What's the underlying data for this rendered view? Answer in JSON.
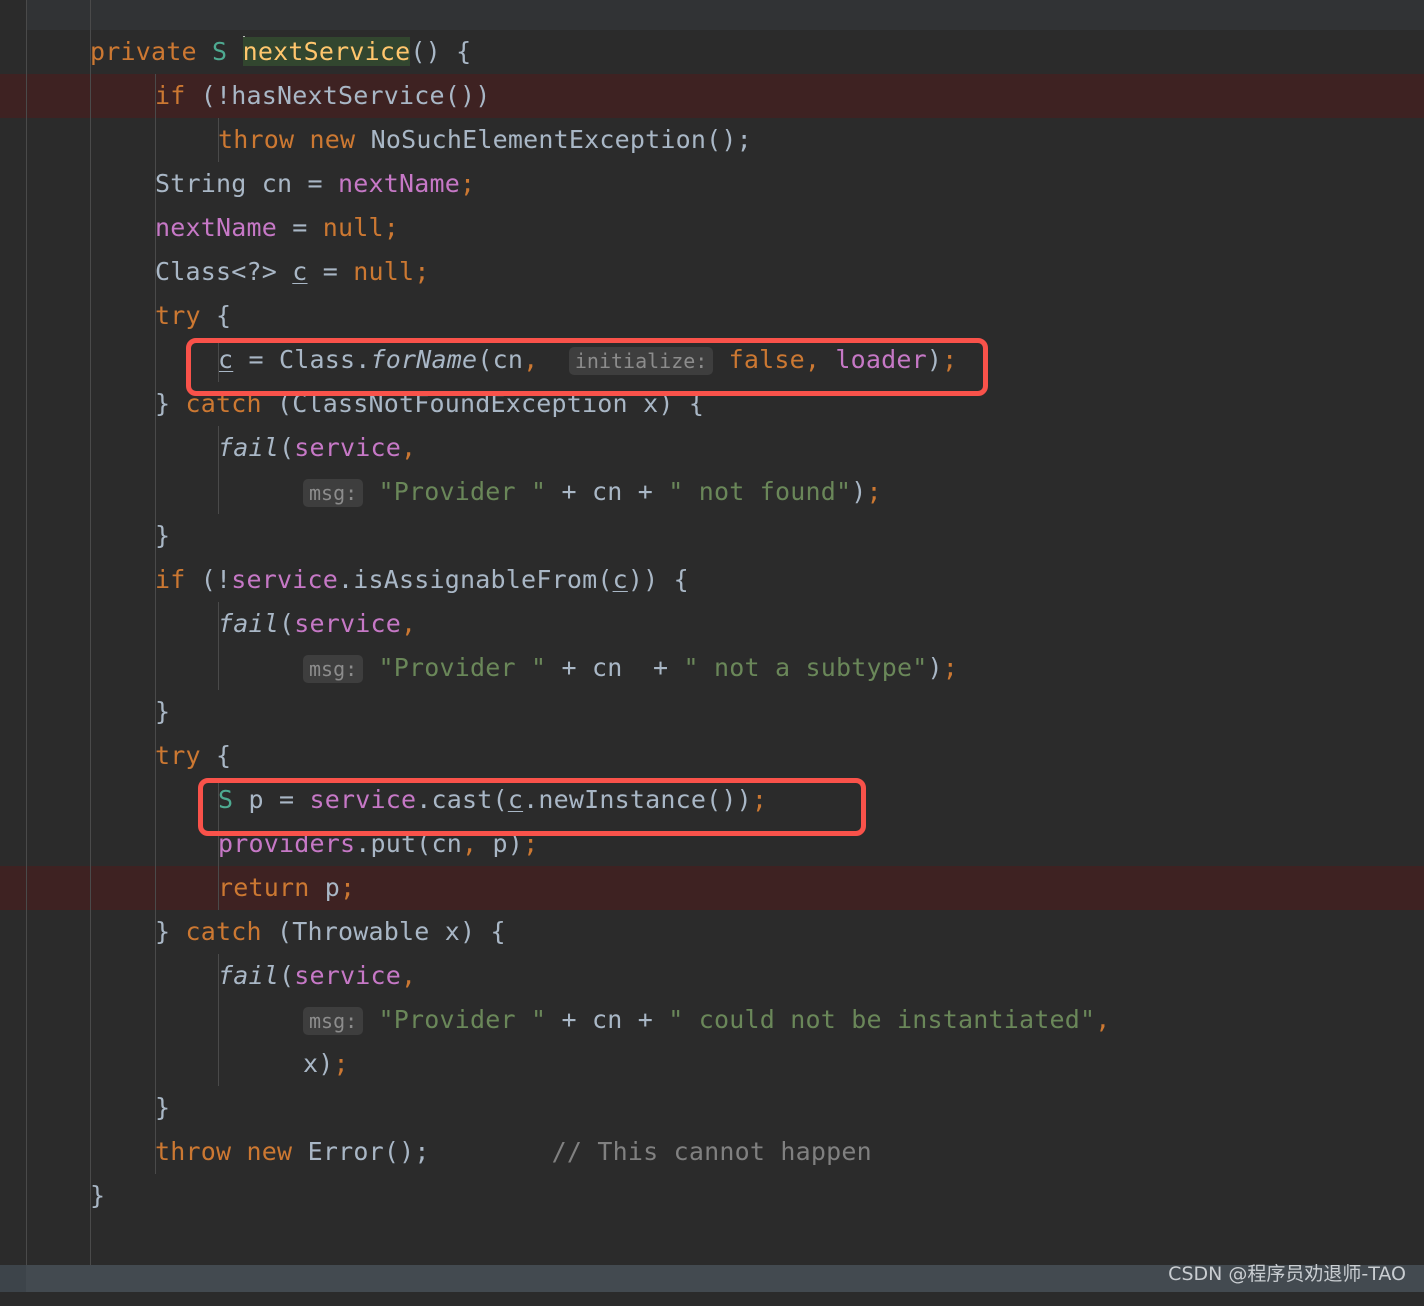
{
  "app": {
    "type": "code-editor",
    "language": "Java",
    "theme": "darcula",
    "background": "#2b2b2b",
    "error_line_background": "#3e2222",
    "annotation_color": "#f9524a",
    "caret_highlight_background": "#32462f"
  },
  "caret": {
    "highlighted_identifier": "nextService"
  },
  "annotations": [
    {
      "name": "forName-call-box",
      "target_line": 8,
      "label": "red rounded rectangle around Class.forName call"
    },
    {
      "name": "newInstance-call-box",
      "target_line": 18,
      "label": "red rounded rectangle around service.cast newInstance call"
    }
  ],
  "inlay_hints": [
    {
      "name": "initialize-hint",
      "text": "initialize:"
    },
    {
      "name": "msg-hint-1",
      "text": "msg:"
    },
    {
      "name": "msg-hint-2",
      "text": "msg:"
    },
    {
      "name": "msg-hint-3",
      "text": "msg:"
    }
  ],
  "code": {
    "l1": {
      "kw_private": "private",
      "gen_S": "S",
      "method": "nextService",
      "tail": "() {"
    },
    "l2": {
      "kw_if": "if",
      "body": " (!hasNextService())"
    },
    "l3": {
      "kw_throw": "throw",
      "kw_new": "new",
      "cls": "NoSuchElementException",
      "tail": "();"
    },
    "l4": {
      "cls": "String",
      "var": " cn = ",
      "fld": "nextName",
      "semi": ";"
    },
    "l5": {
      "fld": "nextName",
      "op": " = ",
      "kw_null": "null",
      "semi": ";"
    },
    "l6": {
      "cls": "Class<?> ",
      "lvar": "c",
      "op": " = ",
      "kw_null": "null",
      "semi": ";"
    },
    "l7": {
      "kw_try": "try",
      "tail": " {"
    },
    "l8": {
      "lvar": "c",
      "op": " = ",
      "cls": "Class.",
      "mth_ital": "forName",
      "p1": "(cn",
      "comma1": ",",
      "hint": "initialize:",
      "kw_false": "false",
      "comma2": ",",
      "fld_loader": "loader",
      "tail": ")",
      "semi": ";"
    },
    "l9": {
      "brace": "} ",
      "kw_catch": "catch",
      "tail": " (ClassNotFoundException x) {"
    },
    "l10": {
      "mth_ital": "fail",
      "paren": "(",
      "fld": "service",
      "comma": ","
    },
    "l11": {
      "hint": "msg:",
      "s1": "\"Provider \"",
      "op1": " + ",
      "cn": "cn",
      "op2": " + ",
      "s2": "\" not found\"",
      "tail": ")",
      "semi": ";"
    },
    "l12": {
      "brace": "}"
    },
    "l13": {
      "kw_if": "if",
      "p1": " (!",
      "fld": "service",
      "p2": ".isAssignableFrom(",
      "lvar": "c",
      "p3": ")) {"
    },
    "l14": {
      "mth_ital": "fail",
      "paren": "(",
      "fld": "service",
      "comma": ","
    },
    "l15": {
      "hint": "msg:",
      "s1": "\"Provider \"",
      "op1": " + ",
      "cn": "cn",
      "op2": "  + ",
      "s2": "\" not a subtype\"",
      "tail": ")",
      "semi": ";"
    },
    "l16": {
      "brace": "}"
    },
    "l17": {
      "kw_try": "try",
      "tail": " {"
    },
    "l18": {
      "gen_S": "S",
      "p": " p = ",
      "fld": "service",
      "p2": ".cast(",
      "lvar": "c",
      "p3": ".newInstance())",
      "semi": ";"
    },
    "l19": {
      "fld": "providers",
      "p1": ".put(cn",
      "comma": ",",
      "p2": " p)",
      "semi": ";"
    },
    "l20": {
      "kw_return": "return",
      "tail": " p",
      "semi": ";"
    },
    "l21": {
      "brace": "} ",
      "kw_catch": "catch",
      "tail": " (Throwable x) {"
    },
    "l22": {
      "mth_ital": "fail",
      "paren": "(",
      "fld": "service",
      "comma": ","
    },
    "l23": {
      "hint": "msg:",
      "s1": "\"Provider \"",
      "op1": " + ",
      "cn": "cn",
      "op2": " + ",
      "s2": "\" could not be instantiated\"",
      "comma": ","
    },
    "l24": {
      "tail": "x)",
      "semi": ";"
    },
    "l25": {
      "brace": "}"
    },
    "l26": {
      "kw_throw": "throw",
      "kw_new": "new",
      "cls": "Error",
      "tail": "();",
      "comment": "// This cannot happen"
    },
    "l27": {
      "brace": "}"
    }
  },
  "footer": {
    "watermark": "CSDN @程序员劝退师-TAO"
  }
}
